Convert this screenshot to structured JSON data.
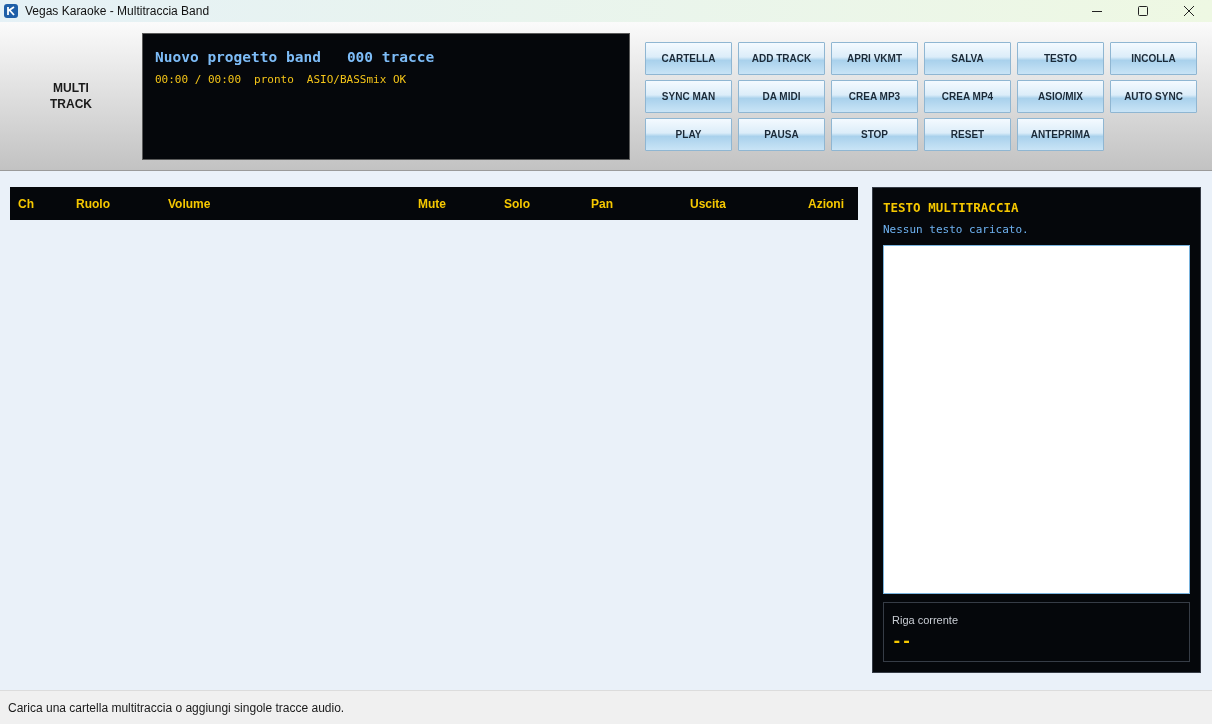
{
  "window": {
    "title": "Vegas Karaoke - Multitraccia Band"
  },
  "header": {
    "mode_label": "MULTI TRACK",
    "display": {
      "project": "Nuovo progetto band",
      "track_count": "000 tracce",
      "time": "00:00 / 00:00",
      "state": "pronto",
      "engine": "ASIO/BASSmix OK"
    }
  },
  "toolbar": {
    "buttons": [
      "CARTELLA",
      "ADD TRACK",
      "APRI VKMT",
      "SALVA",
      "TESTO",
      "INCOLLA",
      "SYNC MAN",
      "DA MIDI",
      "CREA MP3",
      "CREA MP4",
      "ASIO/MIX",
      "AUTO SYNC",
      "PLAY",
      "PAUSA",
      "STOP",
      "RESET",
      "ANTEPRIMA"
    ]
  },
  "table": {
    "columns": [
      "Ch",
      "Ruolo",
      "Volume",
      "Mute",
      "Solo",
      "Pan",
      "Uscita",
      "Azioni"
    ]
  },
  "lyrics_panel": {
    "title": "TESTO MULTITRACCIA",
    "message": "Nessun testo caricato.",
    "current_line": {
      "label": "Riga corrente",
      "value": "--"
    }
  },
  "status_bar": {
    "text": "Carica una cartella multitraccia o aggiungi singole tracce audio."
  }
}
